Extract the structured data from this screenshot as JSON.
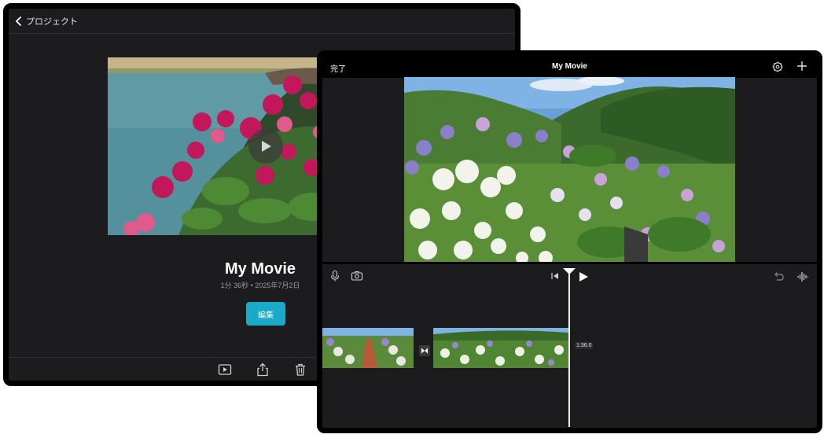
{
  "project_window": {
    "back_label": "プロジェクト",
    "title": "My Movie",
    "meta": "1分 36秒 • 2025年7月2日",
    "edit_label": "編集"
  },
  "editor_window": {
    "done_label": "完了",
    "title": "My Movie",
    "clip_duration": "1:36.0"
  },
  "icons": {
    "back": "chevron-left-icon",
    "play_overlay": "play-icon",
    "bottom": [
      "play-in-box-icon",
      "share-icon",
      "trash-icon"
    ],
    "editor_top": [
      "settings-icon",
      "plus-icon"
    ],
    "editor_tools": [
      "microphone-icon",
      "camera-icon",
      "skip-to-start-icon",
      "play-icon",
      "undo-icon",
      "waveform-icon",
      "transition-icon"
    ]
  },
  "colors": {
    "background": "#1c1c1e",
    "accent": "#1aa9c7",
    "frame": "#000000"
  }
}
